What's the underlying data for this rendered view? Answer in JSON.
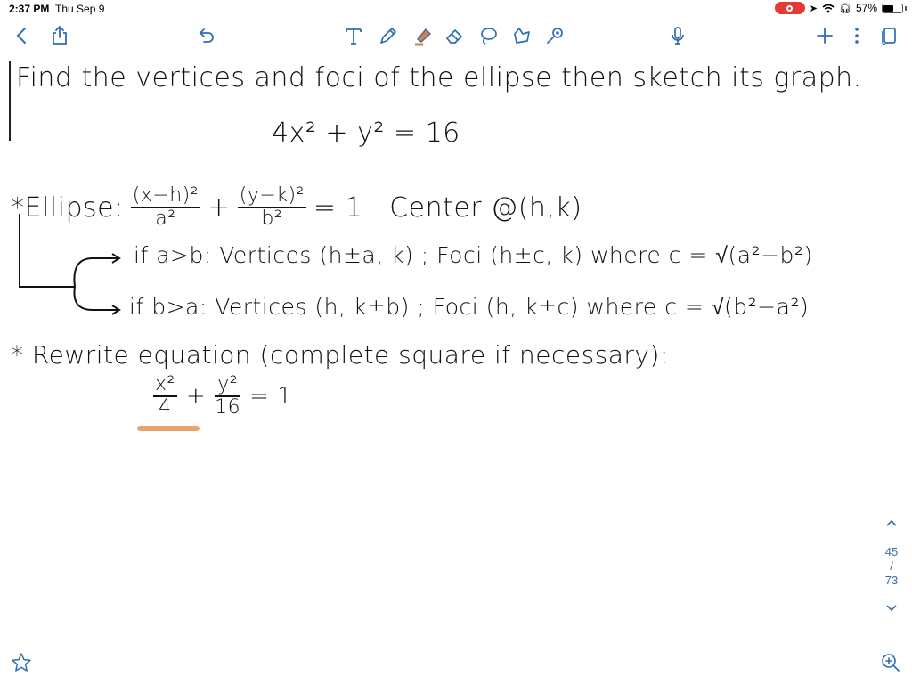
{
  "status": {
    "time": "2:37 PM",
    "date": "Thu Sep 9",
    "battery": "57%",
    "battery_level": 0.57
  },
  "toolbar": {
    "left_icons": [
      "back-chevron-icon",
      "share-icon",
      "undo-icon"
    ],
    "tools": [
      "text-tool-icon",
      "pen-icon",
      "highlighter-icon",
      "eraser-icon",
      "lasso-icon",
      "shapes-icon",
      "laser-pointer-icon"
    ],
    "right_icons": [
      "microphone-icon",
      "plus-icon",
      "more-icon",
      "pages-icon"
    ],
    "highlighter_color": "#e07b39",
    "icon_color": "#2f6db5"
  },
  "note": {
    "title": "Find the vertices and foci of the ellipse then sketch its graph.",
    "given_equation": "4x² + y² = 16",
    "ellipse_label": "*Ellipse:",
    "std_form_num1": "(x−h)²",
    "std_form_den1": "a²",
    "plus": "+",
    "std_form_num2": "(y−k)²",
    "std_form_den2": "b²",
    "std_form_rhs": "= 1",
    "center": "Center @(h,k)",
    "case1": "if a>b: Vertices (h±a, k) ; Foci (h±c, k)  where  c = √(a²−b²)",
    "case2": "if b>a: Vertices (h, k±b) ; Foci (h, k±c)  where  c = √(b²−a²)",
    "rewrite": "* Rewrite equation (complete square if necessary):",
    "rw_num1": "x²",
    "rw_den1": "4",
    "rw_num2": "y²",
    "rw_den2": "16",
    "rw_rhs": "= 1",
    "highlight_color": "#e8a46a"
  },
  "page_nav": {
    "current": "45",
    "separator": "/",
    "total": "73"
  }
}
